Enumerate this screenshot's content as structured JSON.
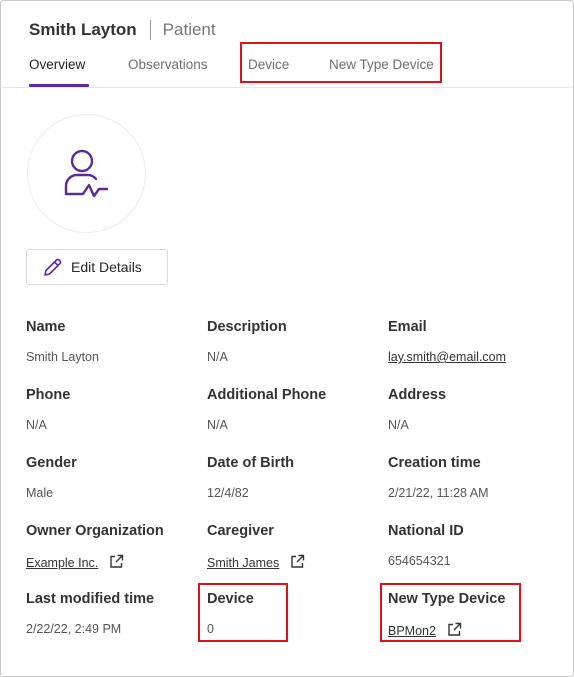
{
  "header": {
    "name": "Smith Layton",
    "type": "Patient"
  },
  "tabs": [
    {
      "label": "Overview",
      "active": true
    },
    {
      "label": "Observations",
      "active": false
    },
    {
      "label": "Device",
      "active": false
    },
    {
      "label": "New Type Device",
      "active": false
    }
  ],
  "avatar": {
    "icon": "patient-icon"
  },
  "edit_button": {
    "label": "Edit Details",
    "icon": "pencil-icon"
  },
  "fields": {
    "name": {
      "label": "Name",
      "value": "Smith Layton"
    },
    "description": {
      "label": "Description",
      "value": "N/A"
    },
    "email": {
      "label": "Email",
      "value": "lay.smith@email.com"
    },
    "phone": {
      "label": "Phone",
      "value": "N/A"
    },
    "additional_phone": {
      "label": "Additional Phone",
      "value": "N/A"
    },
    "address": {
      "label": "Address",
      "value": "N/A"
    },
    "gender": {
      "label": "Gender",
      "value": "Male"
    },
    "date_of_birth": {
      "label": "Date of Birth",
      "value": "12/4/82"
    },
    "creation_time": {
      "label": "Creation time",
      "value": "2/21/22, 11:28 AM"
    },
    "owner_organization": {
      "label": "Owner Organization",
      "value": "Example Inc."
    },
    "caregiver": {
      "label": "Caregiver",
      "value": "Smith James"
    },
    "national_id": {
      "label": "National ID",
      "value": "654654321"
    },
    "last_modified_time": {
      "label": "Last modified time",
      "value": "2/22/22, 2:49 PM"
    },
    "device": {
      "label": "Device",
      "value": "0"
    },
    "new_type_device": {
      "label": "New Type Device",
      "value": "BPMon2"
    }
  },
  "colors": {
    "accent": "#5c2a9d",
    "highlight": "#e0111b"
  }
}
